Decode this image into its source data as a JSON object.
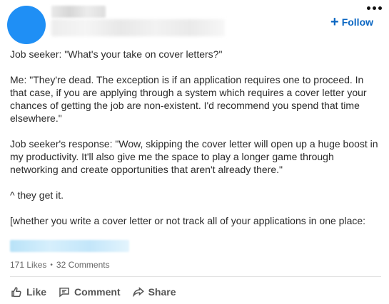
{
  "post": {
    "author_name": "",
    "author_headline": "",
    "follow_label": "Follow",
    "paragraphs": [
      "Job seeker: \"What's your take on cover letters?\"",
      "Me: \"They're dead. The exception is if an application requires one to proceed. In that case, if you are applying through a system which requires a cover letter your chances of getting the job are non-existent. I'd recommend you spend that time elsewhere.\"",
      "Job seeker's response: \"Wow, skipping the cover letter will open up a huge boost in my productivity. It'll also give me the space to play a longer game through networking and create opportunities that aren't already there.\"",
      "^ they get it.",
      "[whether you write a cover letter or not track all of your applications in one place:"
    ]
  },
  "social": {
    "likes": "171 Likes",
    "comments": "32 Comments"
  },
  "actions": {
    "like": "Like",
    "comment": "Comment",
    "share": "Share"
  },
  "colors": {
    "avatar": "#1f8ff5",
    "accent": "#0a66c2"
  },
  "icons": {
    "follow": "plus-icon",
    "menu": "more-horizontal-icon",
    "like": "thumbs-up-icon",
    "comment": "comment-icon",
    "share": "share-arrow-icon"
  }
}
